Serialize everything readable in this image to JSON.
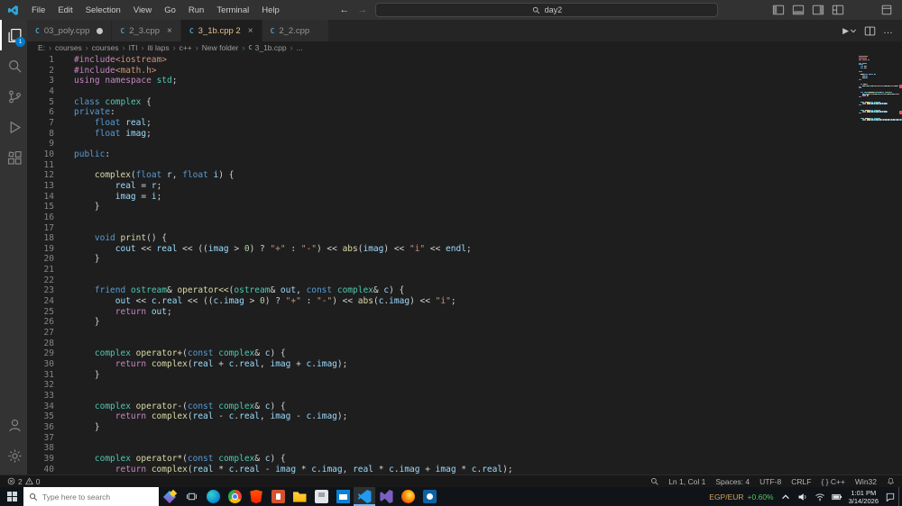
{
  "colors": {
    "accent": "#007acc",
    "error": "#f14c4c",
    "warning": "#cca700",
    "ticker_pair": "#d6a35c",
    "ticker_up": "#57c557",
    "token": {
      "d": "#c586c0",
      "k": "#569cd6",
      "t": "#4ec9b0",
      "v": "#9cdcfe",
      "f": "#dcdcaa",
      "s": "#ce9178",
      "n": "#b5cea8",
      "p": "#d4d4d4"
    }
  },
  "titlebar": {
    "menus": [
      "File",
      "Edit",
      "Selection",
      "View",
      "Go",
      "Run",
      "Terminal",
      "Help"
    ],
    "search_value": "day2"
  },
  "activitybar": {
    "explorer_badge": "1"
  },
  "tabs": [
    {
      "label": "03_poly.cpp",
      "state": "modified",
      "active": false
    },
    {
      "label": "2_3.cpp",
      "state": "close",
      "active": false
    },
    {
      "label": "3_1b.cpp 2",
      "state": "close",
      "active": true
    },
    {
      "label": "2_2.cpp",
      "state": "none",
      "active": false
    }
  ],
  "breadcrumb": [
    "E:",
    "courses",
    "courses",
    "ITI",
    "iti laps",
    "c++",
    "New folder",
    "3_1b.cpp",
    "..."
  ],
  "editor": {
    "problem_lines": [
      19,
      35
    ],
    "lines": [
      [
        [
          "d",
          "#include"
        ],
        [
          "s",
          "<iostream>"
        ]
      ],
      [
        [
          "d",
          "#include"
        ],
        [
          "s",
          "<math.h>"
        ]
      ],
      [
        [
          "d",
          "using"
        ],
        [
          "p",
          " "
        ],
        [
          "d",
          "namespace"
        ],
        [
          "p",
          " "
        ],
        [
          "t",
          "std"
        ],
        [
          "p",
          ";"
        ]
      ],
      [],
      [
        [
          "k",
          "class"
        ],
        [
          "p",
          " "
        ],
        [
          "t",
          "complex"
        ],
        [
          "p",
          " {"
        ]
      ],
      [
        [
          "k",
          "private"
        ],
        [
          "p",
          ":"
        ]
      ],
      [
        [
          "p",
          "    "
        ],
        [
          "k",
          "float"
        ],
        [
          "p",
          " "
        ],
        [
          "v",
          "real"
        ],
        [
          "p",
          ";"
        ]
      ],
      [
        [
          "p",
          "    "
        ],
        [
          "k",
          "float"
        ],
        [
          "p",
          " "
        ],
        [
          "v",
          "imag"
        ],
        [
          "p",
          ";"
        ]
      ],
      [],
      [
        [
          "k",
          "public"
        ],
        [
          "p",
          ":"
        ]
      ],
      [],
      [
        [
          "p",
          "    "
        ],
        [
          "f",
          "complex"
        ],
        [
          "p",
          "("
        ],
        [
          "k",
          "float"
        ],
        [
          "p",
          " "
        ],
        [
          "v",
          "r"
        ],
        [
          "p",
          ", "
        ],
        [
          "k",
          "float"
        ],
        [
          "p",
          " "
        ],
        [
          "v",
          "i"
        ],
        [
          "p",
          ") {"
        ]
      ],
      [
        [
          "p",
          "        "
        ],
        [
          "v",
          "real"
        ],
        [
          "p",
          " = "
        ],
        [
          "v",
          "r"
        ],
        [
          "p",
          ";"
        ]
      ],
      [
        [
          "p",
          "        "
        ],
        [
          "v",
          "imag"
        ],
        [
          "p",
          " = "
        ],
        [
          "v",
          "i"
        ],
        [
          "p",
          ";"
        ]
      ],
      [
        [
          "p",
          "    }"
        ]
      ],
      [],
      [],
      [
        [
          "p",
          "    "
        ],
        [
          "k",
          "void"
        ],
        [
          "p",
          " "
        ],
        [
          "f",
          "print"
        ],
        [
          "p",
          "() {"
        ]
      ],
      [
        [
          "p",
          "        "
        ],
        [
          "v",
          "cout"
        ],
        [
          "p",
          " << "
        ],
        [
          "v",
          "real"
        ],
        [
          "p",
          " << (("
        ],
        [
          "v",
          "imag"
        ],
        [
          "p",
          " > "
        ],
        [
          "n",
          "0"
        ],
        [
          "p",
          ") ? "
        ],
        [
          "s",
          "\"+\""
        ],
        [
          "p",
          " : "
        ],
        [
          "s",
          "\"-\""
        ],
        [
          "p",
          ") << "
        ],
        [
          "f",
          "abs"
        ],
        [
          "p",
          "("
        ],
        [
          "v",
          "imag"
        ],
        [
          "p",
          ") << "
        ],
        [
          "s",
          "\"i\""
        ],
        [
          "p",
          " << "
        ],
        [
          "v",
          "endl"
        ],
        [
          "p",
          ";"
        ]
      ],
      [
        [
          "p",
          "    }"
        ]
      ],
      [],
      [],
      [
        [
          "p",
          "    "
        ],
        [
          "k",
          "friend"
        ],
        [
          "p",
          " "
        ],
        [
          "t",
          "ostream"
        ],
        [
          "p",
          "& "
        ],
        [
          "f",
          "operator<<"
        ],
        [
          "p",
          "("
        ],
        [
          "t",
          "ostream"
        ],
        [
          "p",
          "& "
        ],
        [
          "v",
          "out"
        ],
        [
          "p",
          ", "
        ],
        [
          "k",
          "const"
        ],
        [
          "p",
          " "
        ],
        [
          "t",
          "complex"
        ],
        [
          "p",
          "& "
        ],
        [
          "v",
          "c"
        ],
        [
          "p",
          ") {"
        ]
      ],
      [
        [
          "p",
          "        "
        ],
        [
          "v",
          "out"
        ],
        [
          "p",
          " << "
        ],
        [
          "v",
          "c"
        ],
        [
          "p",
          "."
        ],
        [
          "v",
          "real"
        ],
        [
          "p",
          " << (("
        ],
        [
          "v",
          "c"
        ],
        [
          "p",
          "."
        ],
        [
          "v",
          "imag"
        ],
        [
          "p",
          " > "
        ],
        [
          "n",
          "0"
        ],
        [
          "p",
          ") ? "
        ],
        [
          "s",
          "\"+\""
        ],
        [
          "p",
          " : "
        ],
        [
          "s",
          "\"-\""
        ],
        [
          "p",
          ") << "
        ],
        [
          "f",
          "abs"
        ],
        [
          "p",
          "("
        ],
        [
          "v",
          "c"
        ],
        [
          "p",
          "."
        ],
        [
          "v",
          "imag"
        ],
        [
          "p",
          ") << "
        ],
        [
          "s",
          "\"i\""
        ],
        [
          "p",
          ";"
        ]
      ],
      [
        [
          "p",
          "        "
        ],
        [
          "d",
          "return"
        ],
        [
          "p",
          " "
        ],
        [
          "v",
          "out"
        ],
        [
          "p",
          ";"
        ]
      ],
      [
        [
          "p",
          "    }"
        ]
      ],
      [],
      [],
      [
        [
          "p",
          "    "
        ],
        [
          "t",
          "complex"
        ],
        [
          "p",
          " "
        ],
        [
          "f",
          "operator+"
        ],
        [
          "p",
          "("
        ],
        [
          "k",
          "const"
        ],
        [
          "p",
          " "
        ],
        [
          "t",
          "complex"
        ],
        [
          "p",
          "& "
        ],
        [
          "v",
          "c"
        ],
        [
          "p",
          ") {"
        ]
      ],
      [
        [
          "p",
          "        "
        ],
        [
          "d",
          "return"
        ],
        [
          "p",
          " "
        ],
        [
          "f",
          "complex"
        ],
        [
          "p",
          "("
        ],
        [
          "v",
          "real"
        ],
        [
          "p",
          " + "
        ],
        [
          "v",
          "c"
        ],
        [
          "p",
          "."
        ],
        [
          "v",
          "real"
        ],
        [
          "p",
          ", "
        ],
        [
          "v",
          "imag"
        ],
        [
          "p",
          " + "
        ],
        [
          "v",
          "c"
        ],
        [
          "p",
          "."
        ],
        [
          "v",
          "imag"
        ],
        [
          "p",
          ");"
        ]
      ],
      [
        [
          "p",
          "    }"
        ]
      ],
      [],
      [],
      [
        [
          "p",
          "    "
        ],
        [
          "t",
          "complex"
        ],
        [
          "p",
          " "
        ],
        [
          "f",
          "operator-"
        ],
        [
          "p",
          "("
        ],
        [
          "k",
          "const"
        ],
        [
          "p",
          " "
        ],
        [
          "t",
          "complex"
        ],
        [
          "p",
          "& "
        ],
        [
          "v",
          "c"
        ],
        [
          "p",
          ") {"
        ]
      ],
      [
        [
          "p",
          "        "
        ],
        [
          "d",
          "return"
        ],
        [
          "p",
          " "
        ],
        [
          "f",
          "complex"
        ],
        [
          "p",
          "("
        ],
        [
          "v",
          "real"
        ],
        [
          "p",
          " - "
        ],
        [
          "v",
          "c"
        ],
        [
          "p",
          "."
        ],
        [
          "v",
          "real"
        ],
        [
          "p",
          ", "
        ],
        [
          "v",
          "imag"
        ],
        [
          "p",
          " - "
        ],
        [
          "v",
          "c"
        ],
        [
          "p",
          "."
        ],
        [
          "v",
          "imag"
        ],
        [
          "p",
          ");"
        ]
      ],
      [
        [
          "p",
          "    }"
        ]
      ],
      [],
      [],
      [
        [
          "p",
          "    "
        ],
        [
          "t",
          "complex"
        ],
        [
          "p",
          " "
        ],
        [
          "f",
          "operator*"
        ],
        [
          "p",
          "("
        ],
        [
          "k",
          "const"
        ],
        [
          "p",
          " "
        ],
        [
          "t",
          "complex"
        ],
        [
          "p",
          "& "
        ],
        [
          "v",
          "c"
        ],
        [
          "p",
          ") {"
        ]
      ],
      [
        [
          "p",
          "        "
        ],
        [
          "d",
          "return"
        ],
        [
          "p",
          " "
        ],
        [
          "f",
          "complex"
        ],
        [
          "p",
          "("
        ],
        [
          "v",
          "real"
        ],
        [
          "p",
          " * "
        ],
        [
          "v",
          "c"
        ],
        [
          "p",
          "."
        ],
        [
          "v",
          "real"
        ],
        [
          "p",
          " - "
        ],
        [
          "v",
          "imag"
        ],
        [
          "p",
          " * "
        ],
        [
          "v",
          "c"
        ],
        [
          "p",
          "."
        ],
        [
          "v",
          "imag"
        ],
        [
          "p",
          ", "
        ],
        [
          "v",
          "real"
        ],
        [
          "p",
          " * "
        ],
        [
          "v",
          "c"
        ],
        [
          "p",
          "."
        ],
        [
          "v",
          "imag"
        ],
        [
          "p",
          " + "
        ],
        [
          "v",
          "imag"
        ],
        [
          "p",
          " * "
        ],
        [
          "v",
          "c"
        ],
        [
          "p",
          "."
        ],
        [
          "v",
          "real"
        ],
        [
          "p",
          ");"
        ]
      ]
    ]
  },
  "statusbar": {
    "errors": "2",
    "warnings": "0",
    "cursor": "Ln 1, Col 1",
    "indent": "Spaces: 4",
    "encoding": "UTF-8",
    "eol": "CRLF",
    "language": "{ } C++",
    "config": "Win32"
  },
  "taskbar": {
    "search_placeholder": "Type here to search",
    "apps": [
      "edge",
      "chrome",
      "brave",
      "powerpoint",
      "file-explorer",
      "calculator",
      "mail",
      "vscode",
      "visual-studio",
      "firefox",
      "outlook"
    ],
    "active_app": "vscode",
    "tray": {
      "ticker_pair": "EGP/EUR",
      "ticker_change": "+0.60%",
      "time": "1:01 PM",
      "date": "3/14/2026"
    }
  }
}
